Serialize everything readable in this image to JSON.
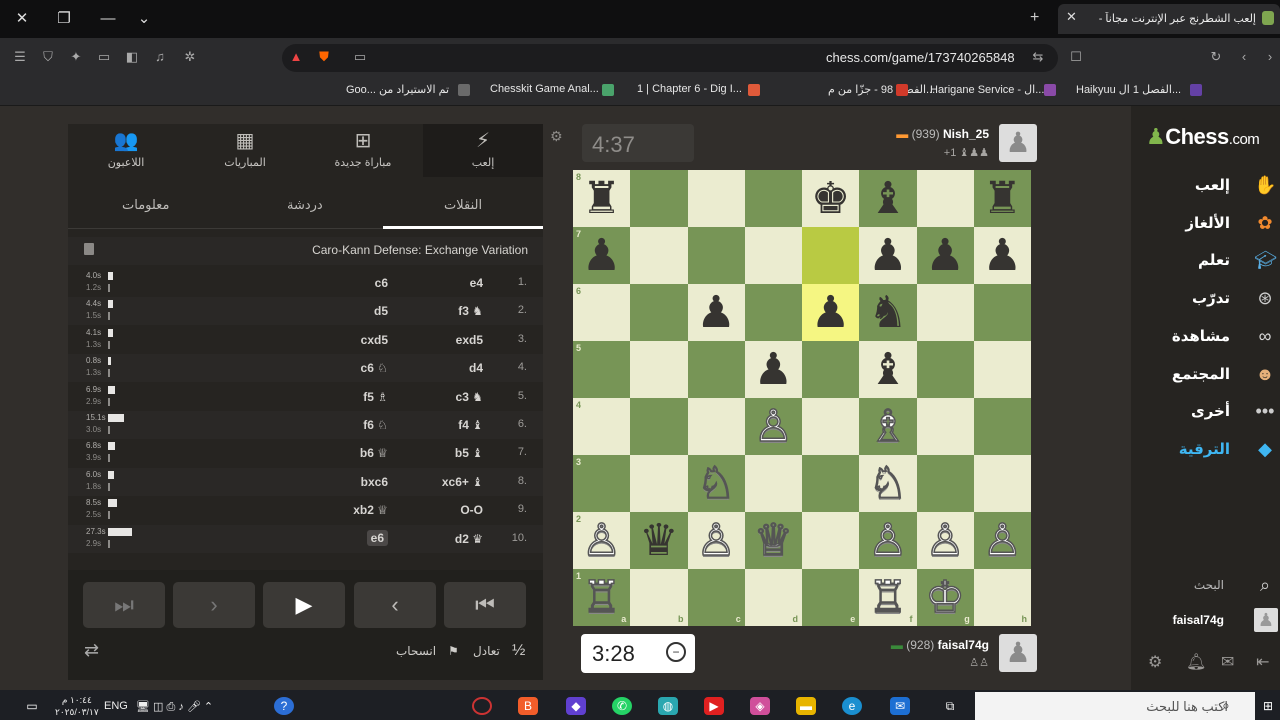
{
  "browser": {
    "tab_title": "إلعب الشطرنج عبر الإنترنت مجاناً -",
    "url": "chess.com/game/173740265848",
    "bookmarks": [
      {
        "label": "Goo... تم الاستيراد من",
        "color": "#6a6a6a"
      },
      {
        "label": "Chesskit Game Anal...",
        "color": "#4aa36b"
      },
      {
        "label": "1 | Chapter 6 - Dig I...",
        "color": "#e05a3a"
      },
      {
        "label": "الفصل 98 - جزّا من م...",
        "color": "#d13a2a"
      },
      {
        "label": "Harigane Service - ال...",
        "color": "#8a4aa8"
      },
      {
        "label": "Haikyuu الفصل 1 ال...",
        "color": "#6441a5"
      }
    ]
  },
  "panel": {
    "tabs": [
      {
        "label": "إلعب",
        "icon": "lightning-icon"
      },
      {
        "label": "مباراة جديدة",
        "icon": "plus-icon"
      },
      {
        "label": "المباريات",
        "icon": "board-icon"
      },
      {
        "label": "اللاعبون",
        "icon": "players-icon"
      }
    ],
    "subtabs": {
      "moves": "النقلات",
      "chat": "دردشة",
      "info": "معلومات"
    },
    "opening": "Caro-Kann Defense: Exchange Variation",
    "moves": [
      {
        "num": "1.",
        "white": "e4",
        "black": "c6",
        "tw": "4.0s",
        "tb": "1.2s",
        "bar": 3
      },
      {
        "num": "2.",
        "white": "f3 ♞",
        "black": "d5",
        "tw": "4.4s",
        "tb": "1.5s",
        "bar": 3
      },
      {
        "num": "3.",
        "white": "exd5",
        "black": "cxd5",
        "tw": "4.1s",
        "tb": "1.3s",
        "bar": 3
      },
      {
        "num": "4.",
        "white": "d4",
        "black": "c6 ♘",
        "tw": "0.8s",
        "tb": "1.3s",
        "bar": 1
      },
      {
        "num": "5.",
        "white": "c3 ♞",
        "black": "f5 ♗",
        "tw": "6.9s",
        "tb": "2.9s",
        "bar": 5
      },
      {
        "num": "6.",
        "white": "f4 ♝",
        "black": "f6 ♘",
        "tw": "15.1s",
        "tb": "3.0s",
        "bar": 14
      },
      {
        "num": "7.",
        "white": "b5 ♝",
        "black": "b6 ♕",
        "tw": "6.8s",
        "tb": "3.9s",
        "bar": 5
      },
      {
        "num": "8.",
        "white": "xc6+ ♝",
        "black": "bxc6",
        "tw": "6.0s",
        "tb": "1.8s",
        "bar": 4
      },
      {
        "num": "9.",
        "white": "O-O",
        "black": "xb2 ♕",
        "tw": "8.5s",
        "tb": "2.5s",
        "bar": 7
      },
      {
        "num": "10.",
        "white": "d2 ♛",
        "black": "e6",
        "tw": "27.3s",
        "tb": "2.9s",
        "bar": 22
      }
    ],
    "draw_label": "تعادل",
    "draw_icon": "½",
    "resign_label": "انسحاب"
  },
  "game": {
    "top_clock": "4:37",
    "bottom_clock": "3:28",
    "top_player": {
      "name": "Nish_25",
      "rating": "(939)",
      "sub": "+1"
    },
    "bottom_player": {
      "name": "faisal74g",
      "rating": "(928)"
    },
    "ranks": [
      "8",
      "7",
      "6",
      "5",
      "4",
      "3",
      "2",
      "1"
    ],
    "files": [
      "a",
      "b",
      "c",
      "d",
      "e",
      "f",
      "g",
      "h"
    ]
  },
  "sidebar": {
    "logo_main": "Chess",
    "logo_suffix": ".com",
    "nav": [
      {
        "label": "إلعب",
        "icon": "play-hand-icon",
        "color": "#e0a070"
      },
      {
        "label": "الألغاز",
        "icon": "puzzle-icon",
        "color": "#f28a2e"
      },
      {
        "label": "تعلم",
        "icon": "graduation-cap-icon",
        "color": "#5ab0e6"
      },
      {
        "label": "تدرّب",
        "icon": "target-icon",
        "color": "#cfcfcf"
      },
      {
        "label": "مشاهدة",
        "icon": "binoculars-icon",
        "color": "#d8d8d8"
      },
      {
        "label": "المجتمع",
        "icon": "community-icon",
        "color": "#e6b07a"
      },
      {
        "label": "أخرى",
        "icon": "dots-icon",
        "color": "#cccccc"
      },
      {
        "label": "الترقية",
        "icon": "diamond-icon",
        "color": "#3fb6f2"
      }
    ],
    "search_label": "البحث",
    "username": "faisal74g"
  },
  "taskbar": {
    "search_placeholder": "اكتب هنا للبحث",
    "lang": "ENG",
    "time": "١٠:٤٤ م",
    "date": "٢٠٢٥/٠٣/١٧"
  }
}
